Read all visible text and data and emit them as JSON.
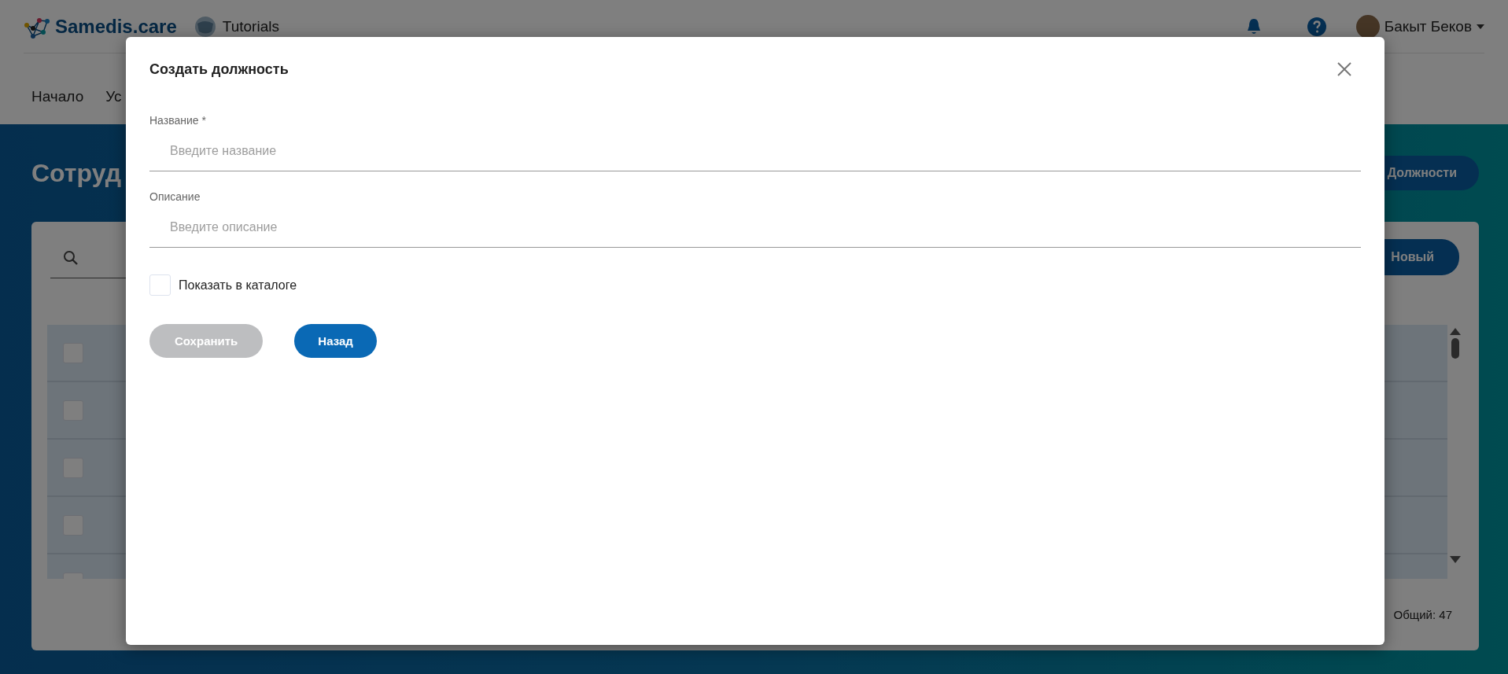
{
  "header": {
    "logo": "Samedis.care",
    "tutorials": "Tutorials",
    "user_name": "Бакыт Беков"
  },
  "nav": [
    {
      "label": "Начало"
    },
    {
      "label": "Ус"
    }
  ],
  "page_title": "Сотруд",
  "positions_button": "Должности",
  "new_button": "Новый",
  "table": {
    "rows": [
      {
        "checked": false
      },
      {
        "checked": false
      },
      {
        "checked": false
      },
      {
        "checked": false
      },
      {
        "checked": false
      }
    ]
  },
  "footer": {
    "total": "Общий: 47"
  },
  "dialog": {
    "title": "Создать должность",
    "fields": [
      {
        "label": "Название *",
        "placeholder": "Введите название"
      },
      {
        "label": "Описание",
        "placeholder": "Введите описание"
      }
    ],
    "checkbox": {
      "label": "Показать в каталоге",
      "checked": false
    },
    "buttons": [
      {
        "label": "Сохранить",
        "disabled": true
      },
      {
        "label": "Назад",
        "disabled": false
      }
    ]
  }
}
